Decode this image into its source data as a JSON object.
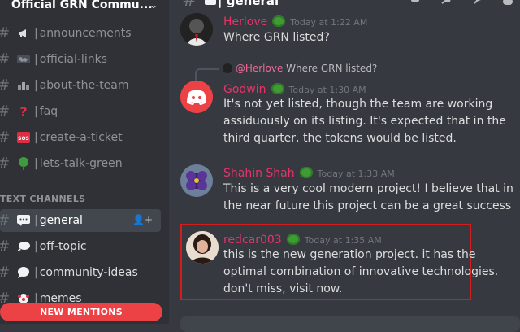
{
  "server": {
    "name": "Official GRN Commu...",
    "chevron_icon": "chevron-down-icon"
  },
  "channels": [
    {
      "id": "announcements",
      "label": "announcements",
      "icon": "megaphone-icon"
    },
    {
      "id": "official-links",
      "label": "official-links",
      "icon": "world-map-icon"
    },
    {
      "id": "about-the-team",
      "label": "about-the-team",
      "icon": "city-icon"
    },
    {
      "id": "faq",
      "label": "faq",
      "icon": "question-icon"
    },
    {
      "id": "create-a-ticket",
      "label": "create-a-ticket",
      "icon": "sos-icon"
    },
    {
      "id": "lets-talk-green",
      "label": "lets-talk-green",
      "icon": "tree-icon"
    }
  ],
  "text_channels_header": "TEXT CHANNELS",
  "text_channels": [
    {
      "id": "general",
      "label": "general",
      "icon": "speech-bubble-icon",
      "selected": true
    },
    {
      "id": "off-topic",
      "label": "off-topic",
      "icon": "speech-bubble-left-icon"
    },
    {
      "id": "community-ideas",
      "label": "community-ideas",
      "icon": "speech-bubble-icon"
    },
    {
      "id": "memes",
      "label": "memes",
      "icon": "clown-icon"
    }
  ],
  "new_mentions": "NEW MENTIONS",
  "header": {
    "channel": "| general"
  },
  "messages": [
    {
      "author": "Herlove",
      "author_color": "#e6346b",
      "timestamp": "Today at 1:22 AM",
      "text": "Where GRN listed?"
    },
    {
      "reply_to_author": "@Herlove",
      "reply_to_text": "Where GRN listed?",
      "author": "Godwin",
      "author_color": "#e6346b",
      "timestamp": "Today at 1:30 AM",
      "text_lines": [
        "It's not yet listed, though the team are working",
        "assiduously on its listing. It's expected that in the",
        "third quarter, the tokens would be listed."
      ]
    },
    {
      "author": "Shahin Shah",
      "author_color": "#e6346b",
      "timestamp": "Today at 1:33 AM",
      "text_lines": [
        "This is a very cool modern project! I believe that in",
        "the near future this project can be a great success"
      ]
    },
    {
      "author": "redcar003",
      "author_color": "#e6346b",
      "timestamp": "Today at 1:35 AM",
      "text_lines": [
        "this is the new generation project. it has the",
        "optimal combination of innovative technologies.",
        "don't miss, visit now."
      ]
    }
  ],
  "colors": {
    "accent_red": "#ed4245",
    "highlight": "#d41c1c",
    "discord_blurple": "#5865f2",
    "discord_red_avatar": "#ed4245"
  }
}
